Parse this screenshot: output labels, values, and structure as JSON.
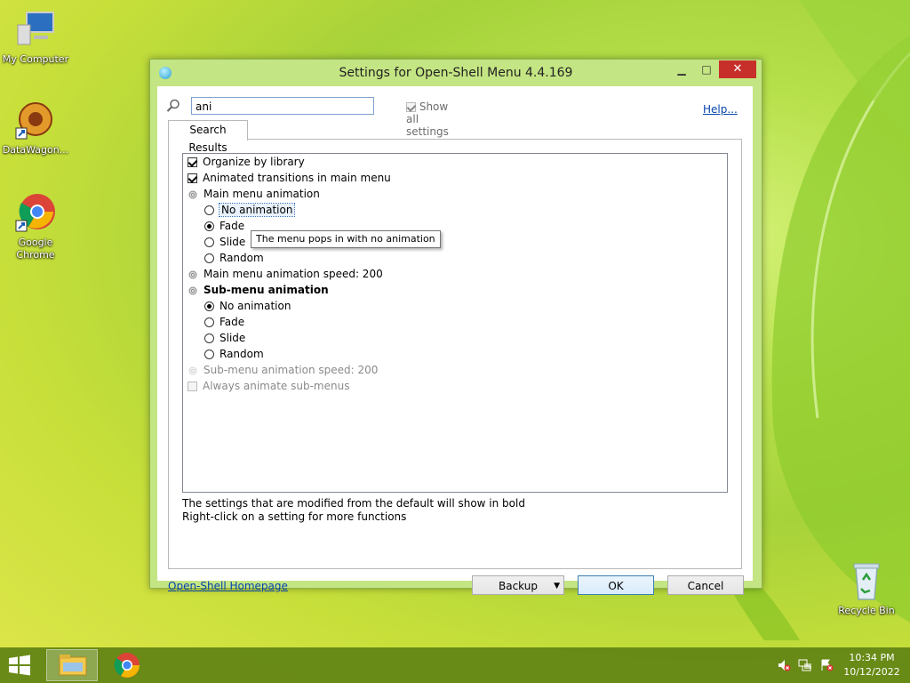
{
  "desktop": {
    "icons": [
      {
        "label": "My Computer",
        "icon": "computer-icon"
      },
      {
        "label": "DataWagon...",
        "icon": "datawagon-icon"
      },
      {
        "label": "Google Chrome",
        "icon": "chrome-icon"
      },
      {
        "label": "Recycle Bin",
        "icon": "recycle-bin-icon"
      }
    ]
  },
  "window": {
    "title": "Settings for Open-Shell Menu 4.4.169",
    "minimize": "▁",
    "maximize": "□",
    "close": "✕",
    "search": {
      "value": "ani"
    },
    "show_all": {
      "label": "Show all settings",
      "checked": true
    },
    "help_link": "Help...",
    "tab_label": "Search Results",
    "tree": [
      {
        "type": "checkbox",
        "label": "Organize by library",
        "checked": true
      },
      {
        "type": "checkbox",
        "label": "Animated transitions in main menu",
        "checked": true
      },
      {
        "type": "group",
        "label": "Main menu animation"
      },
      {
        "type": "radio",
        "label": "No animation",
        "checked": false,
        "focused": true
      },
      {
        "type": "radio",
        "label": "Fade",
        "checked": true
      },
      {
        "type": "radio",
        "label": "Slide",
        "checked": false
      },
      {
        "type": "radio",
        "label": "Random",
        "checked": false
      },
      {
        "type": "setting",
        "label": "Main menu animation speed: 200"
      },
      {
        "type": "group",
        "label": "Sub-menu animation",
        "bold": true
      },
      {
        "type": "radio",
        "label": "No animation",
        "checked": true
      },
      {
        "type": "radio",
        "label": "Fade",
        "checked": false
      },
      {
        "type": "radio",
        "label": "Slide",
        "checked": false
      },
      {
        "type": "radio",
        "label": "Random",
        "checked": false
      },
      {
        "type": "setting",
        "label": "Sub-menu animation speed: 200",
        "disabled": true
      },
      {
        "type": "checkbox",
        "label": "Always animate sub-menus",
        "checked": false,
        "disabled": true
      }
    ],
    "tooltip": "The menu pops in with no animation",
    "note_1": "The settings that are modified from the default will show in bold",
    "note_2": "Right-click on a setting for more functions",
    "homepage_link": "Open-Shell Homepage",
    "buttons": {
      "backup": "Backup",
      "ok": "OK",
      "cancel": "Cancel"
    }
  },
  "taskbar": {
    "time": "10:34 PM",
    "date": "10/12/2022"
  },
  "colors": {
    "accent": "#c7302a",
    "window_frame": "#c4e583",
    "taskbar": "#5f8214",
    "link": "#0645ad"
  }
}
